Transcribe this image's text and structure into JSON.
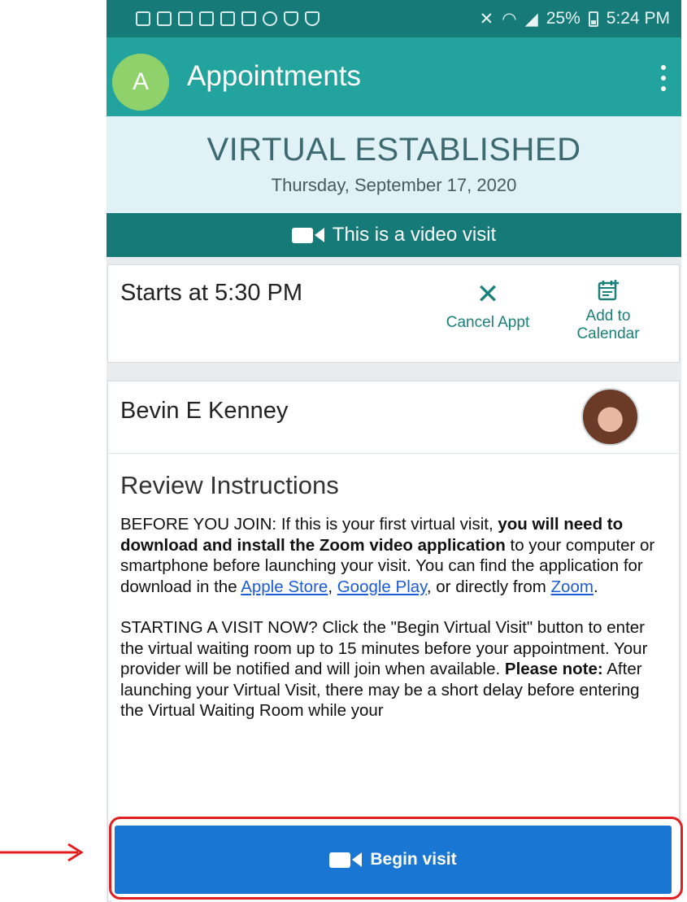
{
  "status_bar": {
    "battery": "25%",
    "time": "5:24 PM",
    "notification_icons": [
      "mail-icon",
      "mail-icon",
      "mail-icon",
      "notification-icon",
      "image-icon",
      "bag-icon",
      "person-icon",
      "shield-icon",
      "shield-icon"
    ]
  },
  "app_bar": {
    "avatar_initial": "A",
    "title": "Appointments"
  },
  "appointment": {
    "type": "VIRTUAL ESTABLISHED",
    "date": "Thursday, September 17, 2020",
    "video_banner": "This is a video visit",
    "start_time": "Starts at 5:30 PM",
    "cancel_label": "Cancel Appt",
    "add_calendar_label": "Add to Calendar"
  },
  "provider": {
    "name": "Bevin E Kenney"
  },
  "instructions": {
    "title": "Review Instructions",
    "p1_a": "BEFORE YOU JOIN: If this is your first virtual visit, ",
    "p1_b": "you will need to download and install the Zoom video application",
    "p1_c": " to your computer or smartphone before launching your visit. You can find the application for download in the ",
    "link_apple": "Apple Store",
    "p1_sep1": ", ",
    "link_google": "Google Play",
    "p1_sep2": ", or directly from ",
    "link_zoom": "Zoom",
    "p1_end": ".",
    "p2_a": "STARTING A VISIT NOW? Click the \"Begin Virtual Visit\" button to enter the virtual waiting room up to 15 minutes before your appointment. Your provider will be notified and will join when available. ",
    "p2_b": "Please note:",
    "p2_c": " After launching your Virtual Visit, there may be a short delay before entering the Virtual Waiting Room while your"
  },
  "begin_button": {
    "label": "Begin visit"
  },
  "colors": {
    "status_bar": "#167a78",
    "app_bar": "#23a39d",
    "header_bg": "#e0f2f5",
    "accent_teal": "#1b8079",
    "begin_button": "#1976d2",
    "highlight": "#e02020"
  }
}
